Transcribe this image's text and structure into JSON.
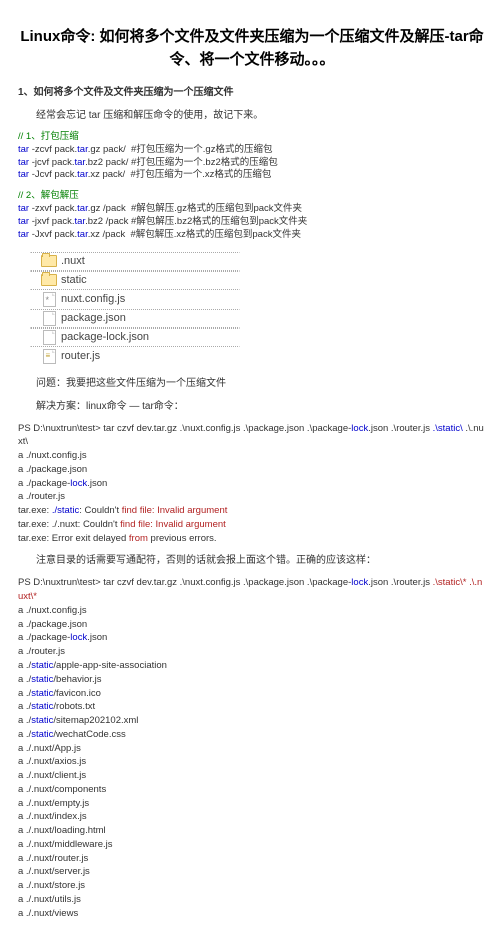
{
  "title": "Linux命令:  如何将多个文件及文件夹压缩为一个压缩文件及解压-tar命令、将一个文件移动。。。",
  "h1": "1、如何将多个文件及文件夹压缩为一个压缩文件",
  "intro": "经常会忘记 tar 压缩和解压命令的使用，故记下来。",
  "sec1_title": "// 1、打包压缩",
  "sec1": [
    {
      "p": "tar",
      "mid": " -zcvf pack.",
      "f": "tar",
      "s": ".gz pack/  #打包压缩为一个.gz格式的压缩包"
    },
    {
      "p": "tar",
      "mid": " -jcvf pack.",
      "f": "tar",
      "s": ".bz2 pack/ #打包压缩为一个.bz2格式的压缩包"
    },
    {
      "p": "tar",
      "mid": " -Jcvf pack.",
      "f": "tar",
      "s": ".xz pack/  #打包压缩为一个.xz格式的压缩包"
    }
  ],
  "sec2_title": "// 2、解包解压",
  "sec2": [
    {
      "p": "tar",
      "mid": " -zxvf pack.",
      "f": "tar",
      "s": ".gz /pack  #解包解压.gz格式的压缩包到pack文件夹"
    },
    {
      "p": "tar",
      "mid": " -jxvf pack.",
      "f": "tar",
      "s": ".bz2 /pack #解包解压.bz2格式的压缩包到pack文件夹"
    },
    {
      "p": "tar",
      "mid": " -Jxvf pack.",
      "f": "tar",
      "s": ".xz /pack  #解包解压.xz格式的压缩包到pack文件夹"
    }
  ],
  "tree": [
    {
      "ind": 0,
      "icon": "folder",
      "name": ".nuxt",
      "dot": true
    },
    {
      "ind": 0,
      "icon": "folder",
      "name": "static",
      "dot": true
    },
    {
      "ind": 1,
      "icon": "gear",
      "name": "nuxt.config.js",
      "dot": false
    },
    {
      "ind": 1,
      "icon": "page",
      "name": "package.json",
      "dot": true
    },
    {
      "ind": 1,
      "icon": "page",
      "name": "package-lock.json",
      "dot": true
    },
    {
      "ind": 1,
      "icon": "js",
      "name": "router.js",
      "dot": false
    }
  ],
  "question": "问题：我要把这些文件压缩为一个压缩文件",
  "solution": "解决方案：linux命令 — tar命令：",
  "ps1": {
    "line1_pre": "PS D:\\nuxtrun\\test> tar czvf dev.tar.gz .\\nuxt.config.js .\\package.json .\\package-",
    "line1_lock": "lock",
    "line1_mid": ".json .\\router.js ",
    "line1_static": ".\\static\\",
    "line1_end": " .\\.nuxt\\",
    "out": [
      "a ./nuxt.config.js",
      "a ./package.json",
      {
        "pre": "a ./package-",
        "lock": "lock",
        "post": ".json"
      },
      "a ./router.js"
    ],
    "err1_pre": "tar.exe: ",
    "err1_static": "./static",
    "err1_mid": ": Couldn't ",
    "err1_red": "find file: Invalid argument",
    "err2_pre": "tar.exe: ./.nuxt: Couldn't ",
    "err2_red": "find file: Invalid argument",
    "err3_pre": "tar.exe: Error exit delayed ",
    "err3_red": "from",
    "err3_post": " previous errors."
  },
  "note": "注意目录的话需要写通配符，否则的话就会报上面这个错。正确的应该这样：",
  "ps2": {
    "line1_pre": "PS D:\\nuxtrun\\test> tar czvf dev.tar.gz .\\nuxt.config.js .\\package.json .\\package-",
    "line1_lock": "lock",
    "line1_mid": ".json .\\router.js ",
    "line1_static": ".\\static\\*",
    "line1_sp": " ",
    "line1_nuxt": ".\\.nuxt\\*",
    "out": [
      "a ./nuxt.config.js",
      "a ./package.json",
      {
        "pre": "a ./package-",
        "lock": "lock",
        "post": ".json"
      },
      "a ./router.js",
      {
        "pre": "a ./",
        "st": "static",
        "post": "/apple-app-site-association"
      },
      {
        "pre": "a ./",
        "st": "static",
        "post": "/behavior.js"
      },
      {
        "pre": "a ./",
        "st": "static",
        "post": "/favicon.ico"
      },
      {
        "pre": "a ./",
        "st": "static",
        "post": "/robots.txt"
      },
      {
        "pre": "a ./",
        "st": "static",
        "post": "/sitemap202102.xml"
      },
      {
        "pre": "a ./",
        "st": "static",
        "post": "/wechatCode.css"
      },
      "a ./.nuxt/App.js",
      "a ./.nuxt/axios.js",
      "a ./.nuxt/client.js",
      "a ./.nuxt/components",
      "a ./.nuxt/empty.js",
      "a ./.nuxt/index.js",
      "a ./.nuxt/loading.html",
      "a ./.nuxt/middleware.js",
      "a ./.nuxt/router.js",
      "a ./.nuxt/server.js",
      "a ./.nuxt/store.js",
      "a ./.nuxt/utils.js",
      "a ./.nuxt/views"
    ]
  }
}
